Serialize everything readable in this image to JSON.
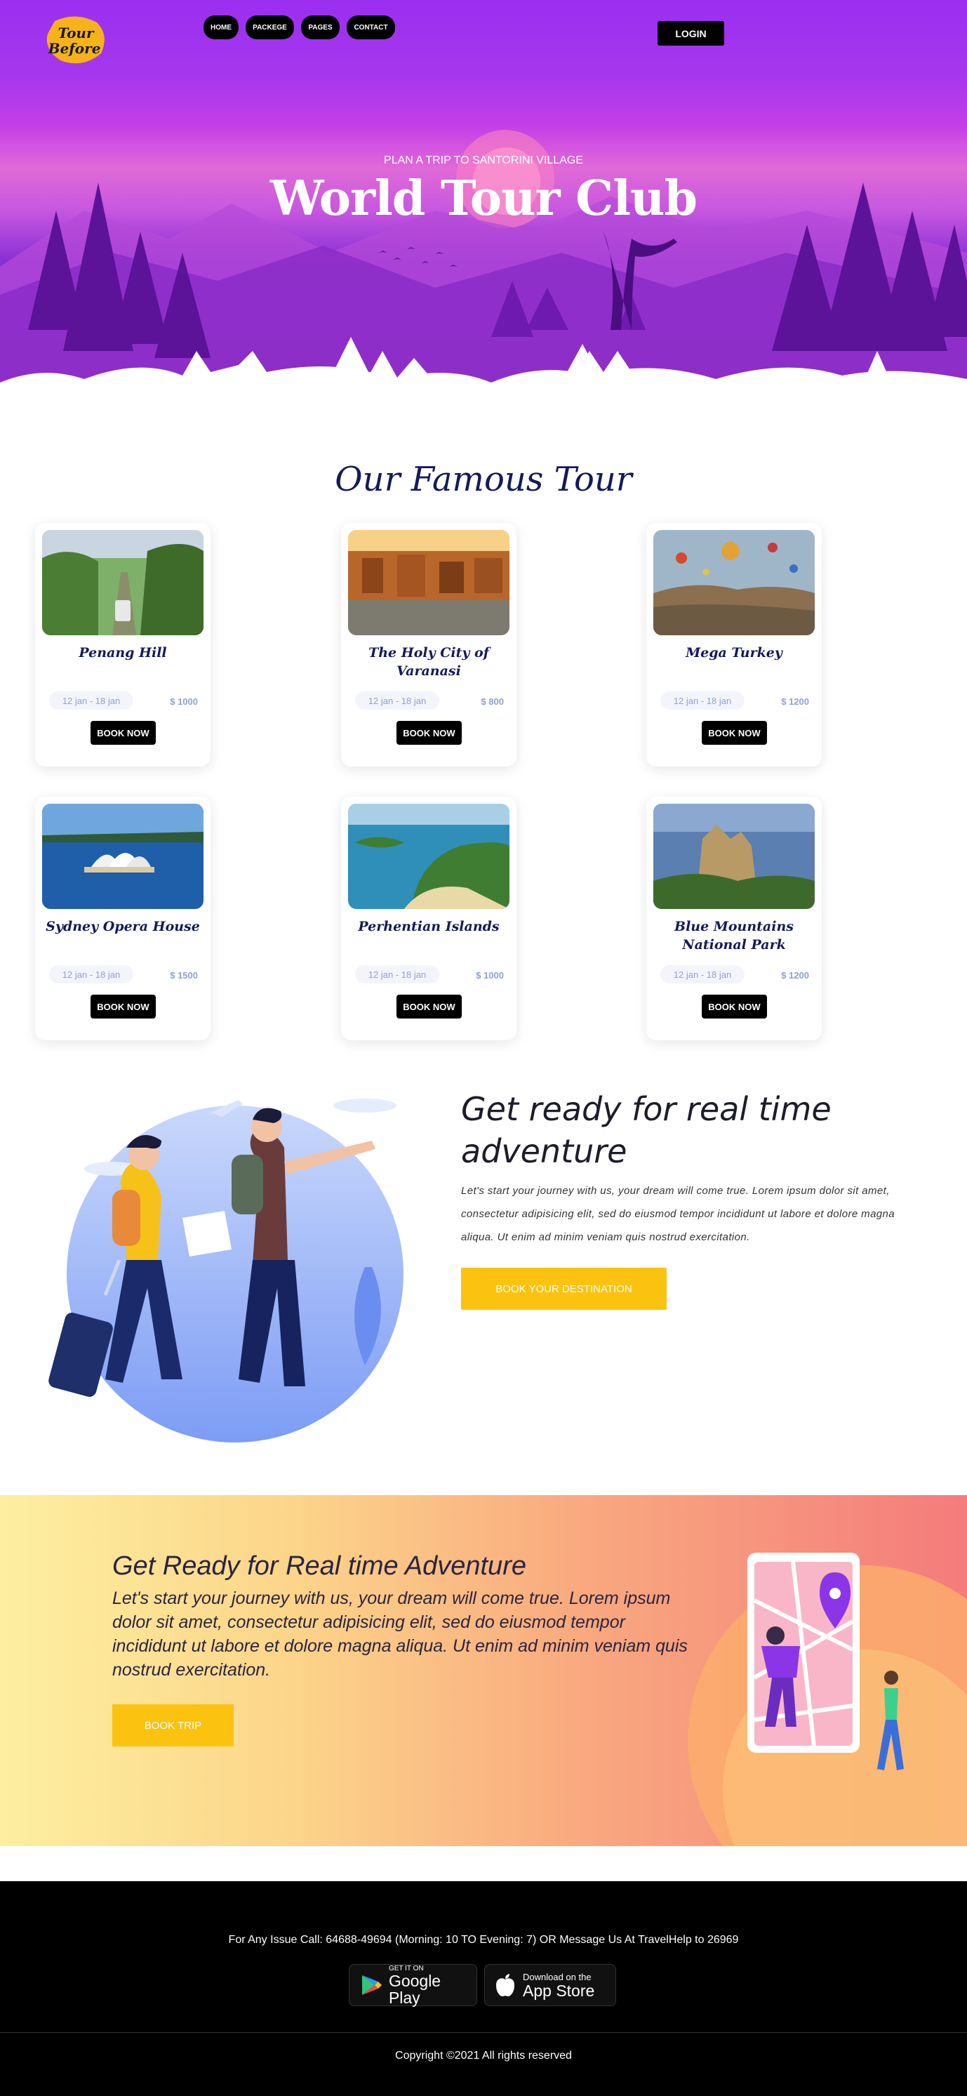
{
  "nav": {
    "logo_text": "Tour Before",
    "items": [
      {
        "label": "HOME"
      },
      {
        "label": "PACKEGE"
      },
      {
        "label": "PAGES"
      },
      {
        "label": "CONTACT"
      }
    ],
    "login_label": "LOGIN"
  },
  "hero": {
    "subtitle": "PLAN A TRIP TO SANTORINI VILLAGE",
    "title": "World Tour Club"
  },
  "tours": {
    "title": "Our Famous Tour",
    "items": [
      {
        "name": "Penang Hill",
        "dates": "12 jan - 18 jan",
        "price": "$ 1000",
        "button": "BOOK NOW"
      },
      {
        "name": "The Holy City of Varanasi",
        "dates": "12 jan - 18 jan",
        "price": "$ 800",
        "button": "BOOK NOW"
      },
      {
        "name": "Mega Turkey",
        "dates": "12 jan - 18 jan",
        "price": "$ 1200",
        "button": "BOOK NOW"
      },
      {
        "name": "Sydney Opera House",
        "dates": "12 jan - 18 jan",
        "price": "$ 1500",
        "button": "BOOK NOW"
      },
      {
        "name": "Perhentian Islands",
        "dates": "12 jan - 18 jan",
        "price": "$ 1000",
        "button": "BOOK NOW"
      },
      {
        "name": "Blue Mountains National Park",
        "dates": "12 jan - 18 jan",
        "price": "$ 1200",
        "button": "BOOK NOW"
      }
    ]
  },
  "adventure": {
    "title": "Get ready for real time adventure",
    "text": "Let's start your journey with us, your dream will come true. Lorem ipsum dolor sit amet, consectetur adipisicing elit, sed do eiusmod tempor incididunt ut labore et dolore magna aliqua. Ut enim ad minim veniam quis nostrud exercitation.",
    "button": "BOOK YOUR DESTINATION"
  },
  "banner": {
    "title": "Get Ready for Real time Adventure",
    "text": "Let's start your journey with us, your dream will come true. Lorem ipsum dolor sit amet, consectetur adipisicing elit, sed do eiusmod tempor incididunt ut labore et dolore magna aliqua. Ut enim ad minim veniam quis nostrud exercitation.",
    "button": "BOOK TRIP"
  },
  "footer": {
    "contact": "For Any Issue Call: 64688-49694 (Morning: 10 TO Evening: 7) OR Message Us At TravelHelp to 26969",
    "google_small": "GET IT ON",
    "google_big": "Google Play",
    "apple_small": "Download on the",
    "apple_big": "App Store",
    "copyright": "Copyright ©2021 All rights reserved"
  },
  "colors": {
    "accent": "#fcc210",
    "heading": "#141a5a",
    "hero_purple": "#9b2ff0"
  }
}
